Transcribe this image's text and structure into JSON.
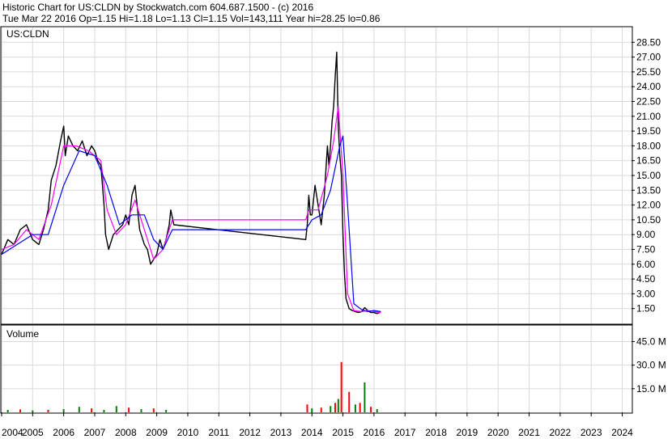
{
  "header": {
    "line1": "Historic Chart for US:CLDN by Stockwatch.com 604.687.1500 - (c) 2016",
    "line2": "Tue Mar 22 2016   Op=1.15   Hi=1.18   Lo=1.13   Cl=1.15   Vol=143,111   Year hi=28.25   lo=0.86"
  },
  "price_panel": {
    "symbol_label": "US:CLDN"
  },
  "volume_panel": {
    "label": "Volume"
  },
  "colors": {
    "price_bars": "#000000",
    "ma_short": "#ff00ff",
    "ma_long": "#0000ff",
    "grid": "#d9d9d9",
    "volume_up": "#008000",
    "volume_down": "#ff0000",
    "text": "#000000",
    "background": "#ffffff"
  },
  "chart_data": {
    "type": "line",
    "title": "Historic Chart for US:CLDN",
    "xlabel": "",
    "ylabel": "",
    "grid": true,
    "x_ticks": [
      "2004",
      "2005",
      "2006",
      "2007",
      "2008",
      "2009",
      "2010",
      "2011",
      "2012",
      "2013",
      "2014",
      "2015",
      "2016",
      "2017",
      "2018",
      "2019",
      "2020",
      "2021",
      "2022",
      "2023",
      "2024"
    ],
    "y_ticks": [
      1.5,
      3.0,
      4.5,
      6.0,
      7.5,
      9.0,
      10.5,
      12.0,
      13.5,
      15.0,
      16.5,
      18.0,
      19.5,
      21.0,
      22.5,
      24.0,
      25.5,
      27.0,
      28.5
    ],
    "y_tick_labels": [
      "1.50",
      "3.00",
      "4.50",
      "6.00",
      "7.50",
      "9.00",
      "10.50",
      "12.00",
      "13.50",
      "15.00",
      "16.50",
      "18.00",
      "19.50",
      "21.00",
      "22.50",
      "24.00",
      "25.50",
      "27.00",
      "28.50"
    ],
    "xlim": [
      2004.0,
      2024.3
    ],
    "ylim": [
      0,
      30.0
    ],
    "series": [
      {
        "type": "line",
        "x": [
          2004.0,
          2004.2,
          2004.4,
          2004.6,
          2004.8,
          2005.0,
          2005.2,
          2005.35,
          2005.5,
          2005.6,
          2005.75,
          2005.9,
          2006.0,
          2006.05,
          2006.15,
          2006.3,
          2006.45,
          2006.6,
          2006.75,
          2006.9,
          2007.0,
          2007.1,
          2007.2,
          2007.3,
          2007.35,
          2007.45,
          2007.6,
          2007.75,
          2007.9,
          2008.0,
          2008.1,
          2008.2,
          2008.3,
          2008.45,
          2008.6,
          2008.7,
          2008.8,
          2008.9,
          2009.0,
          2009.1,
          2009.2,
          2009.3,
          2009.4,
          2009.45,
          2009.55,
          2013.8,
          2013.85,
          2013.9,
          2013.95,
          2014.0,
          2014.1,
          2014.2,
          2014.3,
          2014.4,
          2014.5,
          2014.55,
          2014.6,
          2014.65,
          2014.7,
          2014.75,
          2014.8,
          2014.85,
          2014.9,
          2014.95,
          2015.0,
          2015.05,
          2015.1,
          2015.15,
          2015.2,
          2015.3,
          2015.4,
          2015.5,
          2015.6,
          2015.7,
          2015.8,
          2015.9,
          2016.0,
          2016.1,
          2016.22
        ],
        "y": [
          7.0,
          8.5,
          8.0,
          9.5,
          10.0,
          8.5,
          8.0,
          9.5,
          11.5,
          14.5,
          16.0,
          18.5,
          20.0,
          17.0,
          19.0,
          18.0,
          17.5,
          18.5,
          17.0,
          18.0,
          17.5,
          16.5,
          16.0,
          12.0,
          9.0,
          7.5,
          9.0,
          9.5,
          10.0,
          11.0,
          10.0,
          13.0,
          14.0,
          9.5,
          8.0,
          7.5,
          6.0,
          6.5,
          7.0,
          8.5,
          7.5,
          8.5,
          10.0,
          11.5,
          10.0,
          8.5,
          10.0,
          13.0,
          11.0,
          11.0,
          14.0,
          12.0,
          10.0,
          13.0,
          18.0,
          16.0,
          18.0,
          20.5,
          22.0,
          25.0,
          27.5,
          20.0,
          17.0,
          15.0,
          9.0,
          5.0,
          2.5,
          2.0,
          1.5,
          1.3,
          1.2,
          1.1,
          1.2,
          1.6,
          1.3,
          1.1,
          1.1,
          1.0,
          1.15
        ]
      },
      {
        "name": "",
        "type": "ma_short",
        "x": [
          2004.0,
          2004.4,
          2004.8,
          2005.2,
          2005.6,
          2006.0,
          2006.4,
          2006.8,
          2007.2,
          2007.4,
          2007.7,
          2008.0,
          2008.3,
          2008.6,
          2008.9,
          2009.2,
          2009.5,
          2013.8,
          2013.9,
          2014.2,
          2014.5,
          2014.7,
          2014.85,
          2015.0,
          2015.15,
          2015.35,
          2015.6,
          2015.8,
          2016.0,
          2016.22
        ],
        "y": [
          7.5,
          8.0,
          9.5,
          8.5,
          12.0,
          18.0,
          18.0,
          17.5,
          16.5,
          11.5,
          9.0,
          10.0,
          12.5,
          9.5,
          6.5,
          7.5,
          10.5,
          10.5,
          11.5,
          11.5,
          15.0,
          18.5,
          22.0,
          15.0,
          3.0,
          1.3,
          1.2,
          1.3,
          1.2,
          1.1
        ]
      },
      {
        "name": "",
        "type": "ma_long",
        "x": [
          2004.0,
          2004.5,
          2005.0,
          2005.5,
          2006.0,
          2006.5,
          2007.0,
          2007.4,
          2007.8,
          2008.2,
          2008.6,
          2008.9,
          2009.2,
          2009.5,
          2013.8,
          2014.0,
          2014.3,
          2014.6,
          2014.9,
          2015.0,
          2015.15,
          2015.35,
          2015.6,
          2015.8,
          2016.0,
          2016.22
        ],
        "y": [
          7.0,
          8.0,
          9.0,
          9.0,
          14.0,
          17.5,
          17.0,
          14.0,
          10.0,
          11.0,
          11.0,
          8.5,
          7.5,
          9.5,
          9.5,
          10.5,
          11.0,
          13.5,
          18.0,
          19.0,
          12.0,
          2.0,
          1.4,
          1.2,
          1.3,
          1.2
        ]
      }
    ],
    "volume": {
      "yticks": [
        "15.0 M",
        "30.0 M",
        "45.0 M"
      ],
      "ytick_values": [
        15,
        30,
        45
      ],
      "ylim": [
        0,
        55
      ],
      "x": [
        2004.2,
        2004.6,
        2005.0,
        2005.5,
        2006.0,
        2006.5,
        2006.9,
        2007.3,
        2007.7,
        2008.1,
        2008.5,
        2008.9,
        2009.3,
        2013.85,
        2014.0,
        2014.3,
        2014.6,
        2014.75,
        2014.85,
        2014.95,
        2015.2,
        2015.4,
        2015.55,
        2015.7,
        2015.9,
        2016.1
      ],
      "values": [
        1.5,
        1.8,
        1.2,
        1.6,
        2.0,
        3.5,
        2.5,
        1.5,
        4.0,
        3.0,
        2.0,
        2.5,
        1.5,
        5.0,
        2.5,
        3.0,
        4.0,
        6.0,
        8.5,
        32.0,
        13.0,
        5.0,
        6.0,
        19.0,
        3.5,
        2.0
      ],
      "colors": [
        "green",
        "red",
        "green",
        "red",
        "green",
        "green",
        "red",
        "green",
        "green",
        "red",
        "green",
        "red",
        "green",
        "red",
        "green",
        "red",
        "green",
        "red",
        "green",
        "red",
        "red",
        "green",
        "red",
        "green",
        "red",
        "green"
      ]
    }
  }
}
